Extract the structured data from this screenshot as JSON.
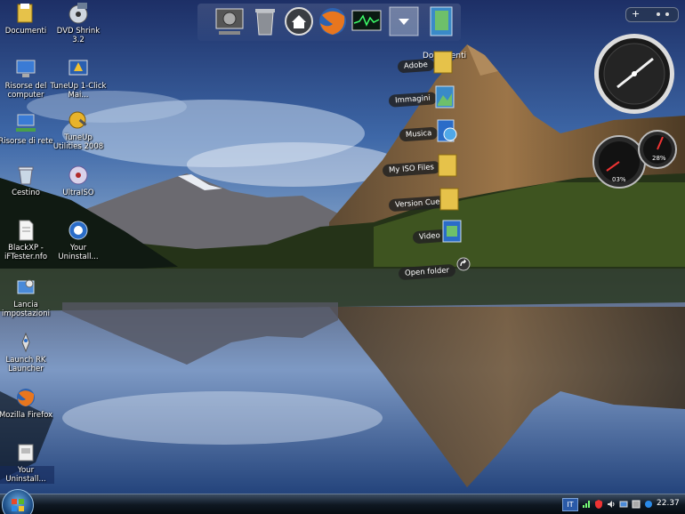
{
  "desktop_icons": [
    {
      "label": "Documenti",
      "icon": "folder-icon"
    },
    {
      "label": "DVD Shrink 3.2",
      "icon": "dvd-shrink-icon"
    },
    {
      "label": "Risorse del computer",
      "icon": "computer-icon"
    },
    {
      "label": "TuneUp 1-Click Mai...",
      "icon": "tuneup-icon"
    },
    {
      "label": "Risorse di rete",
      "icon": "network-icon"
    },
    {
      "label": "TuneUp Utilities 2008",
      "icon": "tuneup-utilities-icon"
    },
    {
      "label": "Cestino",
      "icon": "recycle-bin-icon"
    },
    {
      "label": "UltraISO",
      "icon": "ultraiso-icon"
    },
    {
      "label": "BlackXP - iFTester.nfo",
      "icon": "document-icon"
    },
    {
      "label": "Your Uninstall...",
      "icon": "uninstaller-icon"
    },
    {
      "label": "Lancia impostazioni",
      "icon": "settings-icon"
    },
    {
      "label": "Launch RK Launcher",
      "icon": "rk-launcher-icon"
    },
    {
      "label": "Mozilla Firefox",
      "icon": "firefox-icon"
    },
    {
      "label": "Your Uninstall...",
      "icon": "uninstaller-icon"
    }
  ],
  "dock": {
    "items": [
      "control-panel-icon",
      "recycle-bin-icon",
      "home-icon",
      "firefox-icon",
      "monitor-icon",
      "down-arrow-icon",
      "documents-stack-icon"
    ],
    "stack_title": "Documenti"
  },
  "stack_items": [
    {
      "label": "Adobe",
      "icon": "folder-icon"
    },
    {
      "label": "Immagini",
      "icon": "pictures-icon"
    },
    {
      "label": "Musica",
      "icon": "music-icon"
    },
    {
      "label": "My ISO Files",
      "icon": "folder-icon"
    },
    {
      "label": "Version Cue",
      "icon": "folder-icon"
    },
    {
      "label": "Video",
      "icon": "video-icon"
    }
  ],
  "stack_open_label": "Open folder",
  "gadgets": {
    "gauge_left": "03%",
    "gauge_right": "28%"
  },
  "taskbar": {
    "language": "IT",
    "clock": "22.37"
  },
  "colors": {
    "sky": "#2f4f8f",
    "lake": "#203a6a",
    "forest": "#2a3a1a",
    "mountain": "#8a6a40",
    "taskbar": "#0f1822"
  }
}
